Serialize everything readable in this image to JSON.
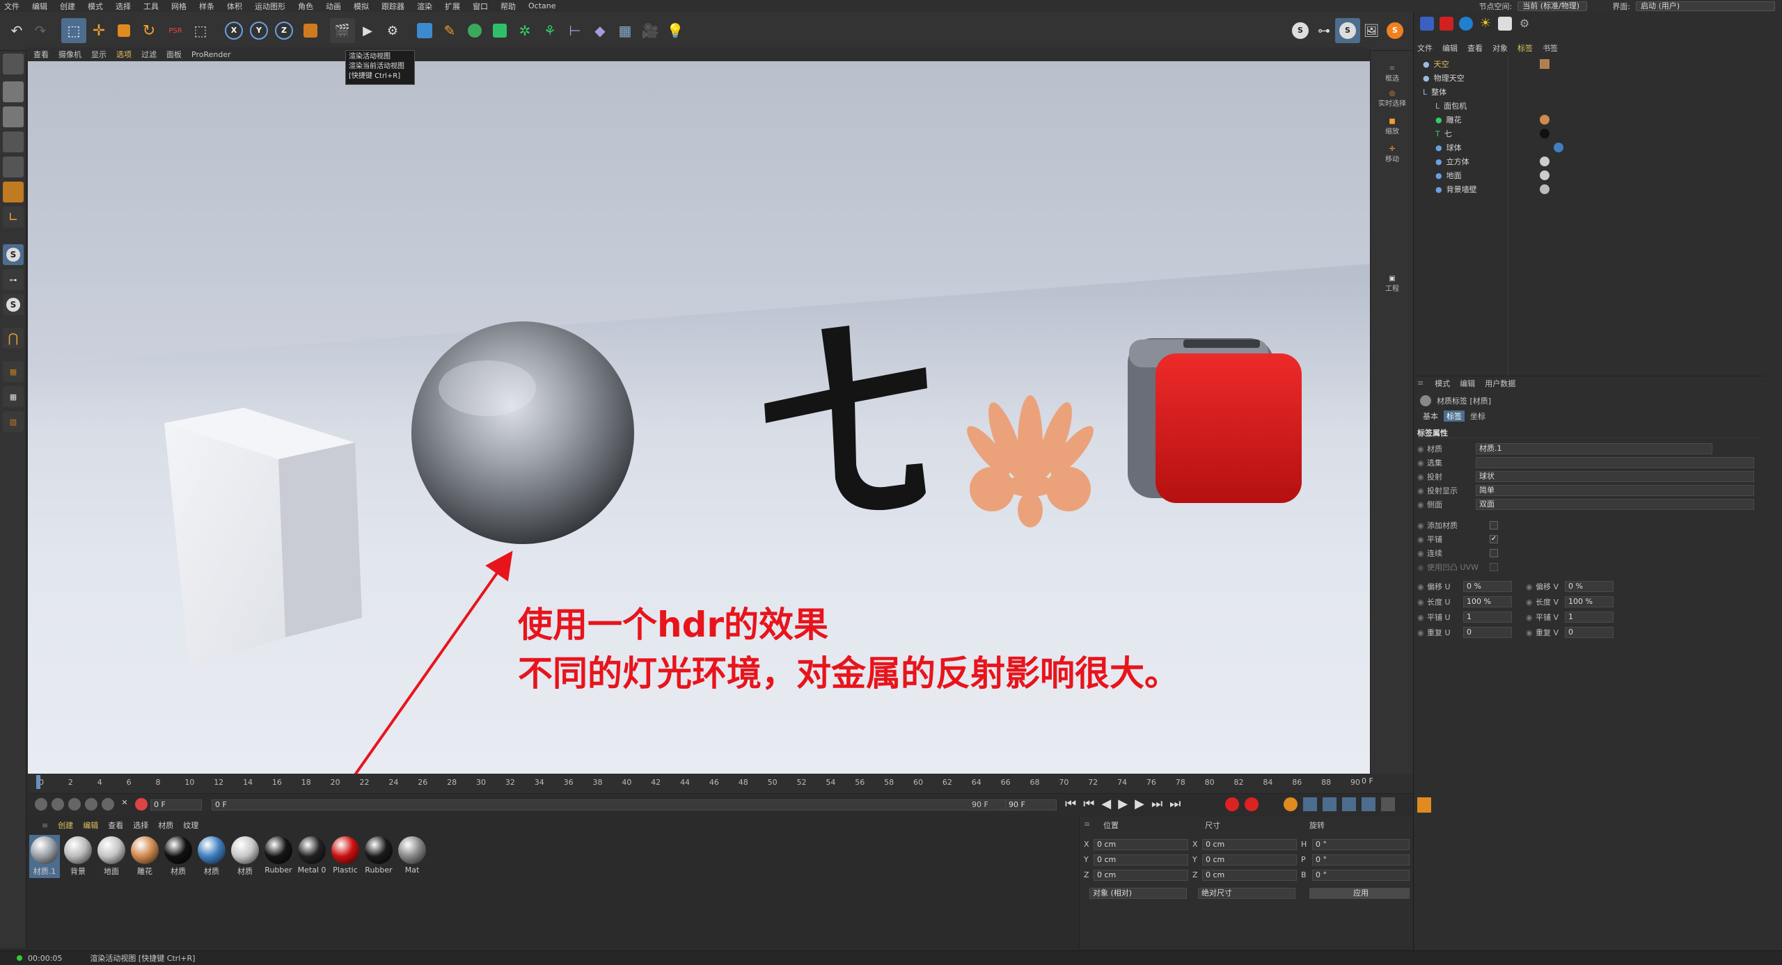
{
  "menubar": {
    "items": [
      "文件",
      "编辑",
      "创建",
      "模式",
      "选择",
      "工具",
      "网格",
      "样条",
      "体积",
      "运动图形",
      "角色",
      "动画",
      "模拟",
      "跟踪器",
      "渲染",
      "扩展",
      "窗口",
      "帮助",
      "Octane"
    ],
    "node_space_label": "节点空间:",
    "node_space_value": "当前 (标准/物理)",
    "interface_label": "界面:",
    "interface_value": "启动 (用户)"
  },
  "tooltip": {
    "line1": "渲染活动视图",
    "line2": "渲染当前活动视图",
    "line3": "[快捷键 Ctrl+R]"
  },
  "viewport": {
    "menu": [
      "查看",
      "摄像机",
      "显示",
      "选项",
      "过滤",
      "面板",
      "ProRender"
    ],
    "annotation_line1": "使用一个hdr的效果",
    "annotation_line2": "不同的灯光环境，对金属的反射影响很大。",
    "glyph": "七",
    "annotation_color": "#e8141c"
  },
  "viewport_side": {
    "items": [
      "框选",
      "实时选择",
      "缩放",
      "移动",
      "工程"
    ]
  },
  "object_manager": {
    "menu": [
      "文件",
      "编辑",
      "查看",
      "对象",
      "标签",
      "书签"
    ],
    "objects": [
      {
        "name": "天空",
        "indent": 0
      },
      {
        "name": "物理天空",
        "indent": 0
      },
      {
        "name": "整体",
        "indent": 0
      },
      {
        "name": "面包机",
        "indent": 1
      },
      {
        "name": "雕花",
        "indent": 1
      },
      {
        "name": "七",
        "indent": 1
      },
      {
        "name": "球体",
        "indent": 1
      },
      {
        "name": "立方体",
        "indent": 1
      },
      {
        "name": "地面",
        "indent": 1
      },
      {
        "name": "背景墙壁",
        "indent": 1
      }
    ]
  },
  "attributes": {
    "menu": [
      "模式",
      "编辑",
      "用户数据"
    ],
    "title": "材质标签 [材质]",
    "tabs": [
      "基本",
      "标签",
      "坐标"
    ],
    "section": "标签属性",
    "material_label": "材质",
    "material_value": "材质.1",
    "selection_label": "选集",
    "projection_label": "投射",
    "projection_value": "球状",
    "projection_display_label": "投射显示",
    "projection_display_value": "简单",
    "side_label": "侧面",
    "side_value": "双面",
    "add_material_label": "添加材质",
    "tile_label": "平铺",
    "seamless_label": "连续",
    "use_uvw_label": "使用凹凸 UVW",
    "offset_u_label": "偏移 U",
    "offset_u": "0 %",
    "offset_v_label": "偏移 V",
    "offset_v": "0 %",
    "length_u_label": "长度 U",
    "length_u": "100 %",
    "length_v_label": "长度 V",
    "length_v": "100 %",
    "tiles_u_label": "平铺 U",
    "tiles_u": "1",
    "tiles_v_label": "平铺 V",
    "tiles_v": "1",
    "repeat_u_label": "重复 U",
    "repeat_u": "0",
    "repeat_v_label": "重复 V",
    "repeat_v": "0"
  },
  "timeline": {
    "ticks": [
      "0",
      "2",
      "4",
      "6",
      "8",
      "10",
      "12",
      "14",
      "16",
      "18",
      "20",
      "22",
      "24",
      "26",
      "28",
      "30",
      "32",
      "34",
      "36",
      "38",
      "40",
      "42",
      "44",
      "46",
      "48",
      "50",
      "52",
      "54",
      "56",
      "58",
      "60",
      "62",
      "64",
      "66",
      "68",
      "70",
      "72",
      "74",
      "76",
      "78",
      "80",
      "82",
      "84",
      "86",
      "88",
      "90"
    ],
    "frame_right": "0 F",
    "start_field": "0 F",
    "current_field": "0 F",
    "end_field": "90 F",
    "end_field2": "90 F"
  },
  "material_manager": {
    "menu": [
      "创建",
      "编辑",
      "查看",
      "选择",
      "材质",
      "纹理"
    ],
    "materials": [
      {
        "label": "材质.1",
        "color": "#9aa0a8"
      },
      {
        "label": "背景",
        "color": "#bbbbbb"
      },
      {
        "label": "地面",
        "color": "#c4c4c4"
      },
      {
        "label": "雕花",
        "color": "#d08a50"
      },
      {
        "label": "材质",
        "color": "#111111"
      },
      {
        "label": "材质",
        "color": "#3f7fc0"
      },
      {
        "label": "材质",
        "color": "#c8c8c8"
      },
      {
        "label": "Rubber",
        "color": "#151515"
      },
      {
        "label": "Metal 0",
        "color": "#222222"
      },
      {
        "label": "Plastic",
        "color": "#cc1111"
      },
      {
        "label": "Rubber",
        "color": "#1a1a1a"
      },
      {
        "label": "Mat",
        "color": "#888888"
      }
    ]
  },
  "coordinates": {
    "position_label": "位置",
    "size_label": "尺寸",
    "rotation_label": "旋转",
    "x_pos": "0 cm",
    "y_pos": "0 cm",
    "z_pos": "0 cm",
    "x_size": "0 cm",
    "y_size": "0 cm",
    "z_size": "0 cm",
    "h_rot": "0 °",
    "p_rot": "0 °",
    "b_rot": "0 °",
    "mode_value": "对象 (相对)",
    "size_mode_value": "绝对尺寸",
    "apply_label": "应用"
  },
  "status": {
    "time": "00:00:05",
    "message": "渲染活动视图 [快捷键 Ctrl+R]"
  }
}
